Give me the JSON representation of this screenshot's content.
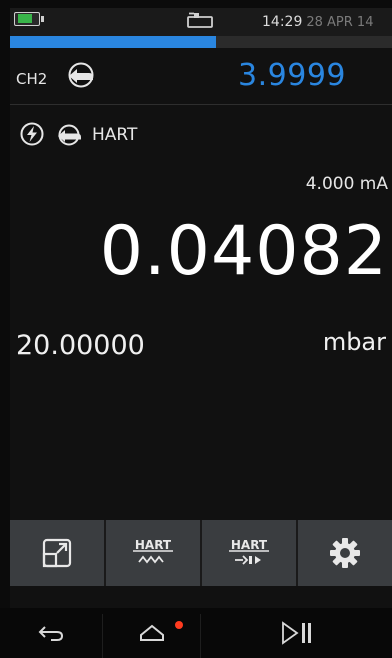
{
  "status_bar": {
    "time": "14:29",
    "date": "28 APR 14",
    "battery_icon": "battery-charging-icon",
    "connection_icon": "usb-connector-icon",
    "progress_fraction": 0.54
  },
  "ch2": {
    "label": "CH2",
    "icon": "hand-pointing-icon",
    "value": "3.9999"
  },
  "hart": {
    "power_icon": "lightning-circle-icon",
    "input_icon": "hand-pointing-icon",
    "label": "HART"
  },
  "readings": {
    "current": "4.000 mA",
    "main_value": "0.04082",
    "range": "20.00000",
    "unit": "mbar"
  },
  "softkeys": [
    {
      "icon": "expand-window-icon"
    },
    {
      "icon": "hart-wave-icon",
      "label": "HART"
    },
    {
      "icon": "hart-connect-icon",
      "label": "HART"
    },
    {
      "icon": "gear-icon"
    }
  ],
  "navbar": {
    "back_icon": "back-arrow-icon",
    "home_icon": "home-icon",
    "play_pause_icon": "play-pause-icon"
  },
  "colors": {
    "accent": "#2a86e0",
    "softkey_bg": "#3a3d40",
    "battery_green": "#39b54a",
    "notification_red": "#ff3b1f"
  }
}
